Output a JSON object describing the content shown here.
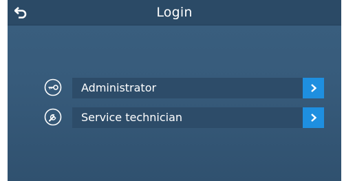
{
  "header": {
    "back_icon": "back-arrow-icon",
    "title": "Login"
  },
  "login_options": [
    {
      "label": "Administrator",
      "icon": "key-icon"
    },
    {
      "label": "Service technician",
      "icon": "wrench-icon"
    }
  ],
  "colors": {
    "background": "#375b7b",
    "header": "#2b4a66",
    "row": "#2d4c69",
    "accent": "#1e8fe0",
    "text": "#ffffff"
  }
}
